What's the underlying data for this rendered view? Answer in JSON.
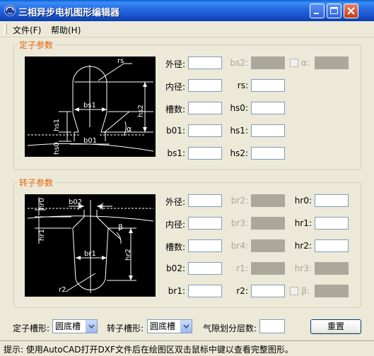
{
  "window": {
    "title": "三相异步电机图形编辑器"
  },
  "menu": {
    "file": "文件(F)",
    "help": "帮助(H)"
  },
  "stator": {
    "group_label": "定子参数",
    "diagram_labels": {
      "rs": "rs",
      "bs1": "bs1",
      "hs2": "hs2",
      "hs1": "hs1",
      "hs0": "hs0",
      "b01": "b01",
      "alpha": "α"
    },
    "fields": [
      {
        "label": "外径:",
        "enabled": true
      },
      {
        "label": "内径:",
        "enabled": true
      },
      {
        "label": "槽数:",
        "enabled": true
      },
      {
        "label": "b01:",
        "enabled": true
      },
      {
        "label": "bs1:",
        "enabled": true
      },
      {
        "label": "bs2:",
        "enabled": false
      },
      {
        "label": "rs:",
        "enabled": true
      },
      {
        "label": "hs0:",
        "enabled": true
      },
      {
        "label": "hs1:",
        "enabled": true
      },
      {
        "label": "hs2:",
        "enabled": true
      },
      {
        "label": "α:",
        "enabled": false
      }
    ]
  },
  "rotor": {
    "group_label": "转子参数",
    "diagram_labels": {
      "hr0": "hr0",
      "b02": "b02",
      "hr1": "hr1",
      "beta": "β",
      "hr2": "hr2",
      "br1": "br1",
      "r2": "r2"
    },
    "fields": [
      {
        "label": "外径:",
        "enabled": true
      },
      {
        "label": "内径:",
        "enabled": true
      },
      {
        "label": "槽数:",
        "enabled": true
      },
      {
        "label": "b02:",
        "enabled": true
      },
      {
        "label": "br1:",
        "enabled": true
      },
      {
        "label": "br2:",
        "enabled": false
      },
      {
        "label": "br3:",
        "enabled": false
      },
      {
        "label": "br4:",
        "enabled": false
      },
      {
        "label": "r1:",
        "enabled": false
      },
      {
        "label": "r2:",
        "enabled": true
      },
      {
        "label": "hr0:",
        "enabled": true
      },
      {
        "label": "hr1:",
        "enabled": true
      },
      {
        "label": "hr2:",
        "enabled": true
      },
      {
        "label": "hr3:",
        "enabled": false
      },
      {
        "label": "β:",
        "enabled": false
      }
    ]
  },
  "bottom": {
    "stator_slot_label": "定子槽形:",
    "stator_slot_value": "圆底槽",
    "rotor_slot_label": "转子槽形:",
    "rotor_slot_value": "圆底槽",
    "airgap_label": "气隙划分层数:",
    "reset_label": "重置"
  },
  "status": {
    "hint": "提示: 使用AutoCAD打开DXF文件后在绘图区双击鼠标中键以查看完整图形。"
  },
  "colors": {
    "title_bar": "#2567E0",
    "group_label": "#E2650E",
    "disabled_input": "#ACA899",
    "drawing_background": "#000000",
    "drawing_lines": "#FFFFFF"
  }
}
